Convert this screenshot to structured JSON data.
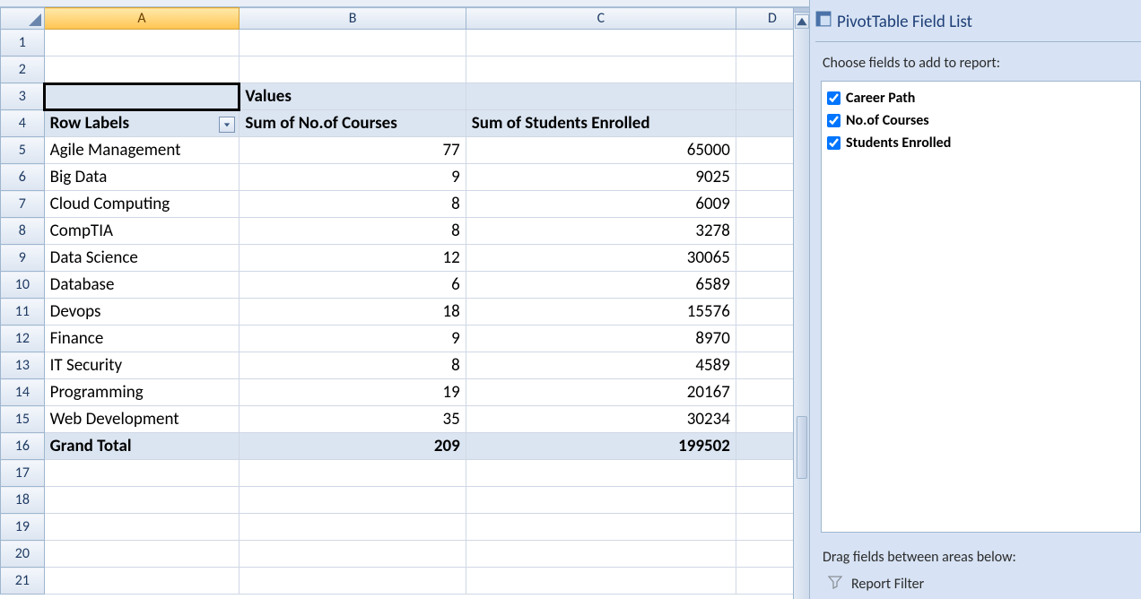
{
  "sheet": {
    "columns": [
      "A",
      "B",
      "C",
      "D"
    ],
    "active_column_index": 0,
    "row_numbers": [
      1,
      2,
      3,
      4,
      5,
      6,
      7,
      8,
      9,
      10,
      11,
      12,
      13,
      14,
      15,
      16,
      17,
      18,
      19,
      20,
      21
    ],
    "active_cell": "A3"
  },
  "pivot_headers": {
    "values_label": "Values",
    "row_labels_label": "Row Labels",
    "col_b_header": "Sum of No.of Courses",
    "col_c_header": "Sum of Students Enrolled"
  },
  "pivot_rows": [
    {
      "label": "Agile Management",
      "courses": 77,
      "students": 65000
    },
    {
      "label": "Big Data",
      "courses": 9,
      "students": 9025
    },
    {
      "label": "Cloud Computing",
      "courses": 8,
      "students": 6009
    },
    {
      "label": "CompTIA",
      "courses": 8,
      "students": 3278
    },
    {
      "label": "Data Science",
      "courses": 12,
      "students": 30065
    },
    {
      "label": "Database",
      "courses": 6,
      "students": 6589
    },
    {
      "label": "Devops",
      "courses": 18,
      "students": 15576
    },
    {
      "label": "Finance",
      "courses": 9,
      "students": 8970
    },
    {
      "label": "IT Security",
      "courses": 8,
      "students": 4589
    },
    {
      "label": "Programming",
      "courses": 19,
      "students": 20167
    },
    {
      "label": "Web Development",
      "courses": 35,
      "students": 30234
    }
  ],
  "pivot_total": {
    "label": "Grand Total",
    "courses": 209,
    "students": 199502
  },
  "pane": {
    "title": "PivotTable Field List",
    "choose_hint": "Choose fields to add to report:",
    "fields": [
      {
        "label": "Career Path",
        "checked": true
      },
      {
        "label": "No.of Courses",
        "checked": true
      },
      {
        "label": "Students Enrolled",
        "checked": true
      }
    ],
    "drag_hint": "Drag fields between areas below:",
    "areas": {
      "report_filter_label": "Report Filter"
    }
  },
  "chart_data": {
    "type": "table",
    "title": "PivotTable: Sum of No.of Courses and Sum of Students Enrolled by Career Path",
    "columns": [
      "Row Labels",
      "Sum of No.of Courses",
      "Sum of Students Enrolled"
    ],
    "rows": [
      [
        "Agile Management",
        77,
        65000
      ],
      [
        "Big Data",
        9,
        9025
      ],
      [
        "Cloud Computing",
        8,
        6009
      ],
      [
        "CompTIA",
        8,
        3278
      ],
      [
        "Data Science",
        12,
        30065
      ],
      [
        "Database",
        6,
        6589
      ],
      [
        "Devops",
        18,
        15576
      ],
      [
        "Finance",
        9,
        8970
      ],
      [
        "IT Security",
        8,
        4589
      ],
      [
        "Programming",
        19,
        20167
      ],
      [
        "Web Development",
        35,
        30234
      ]
    ],
    "totals": [
      "Grand Total",
      209,
      199502
    ]
  }
}
